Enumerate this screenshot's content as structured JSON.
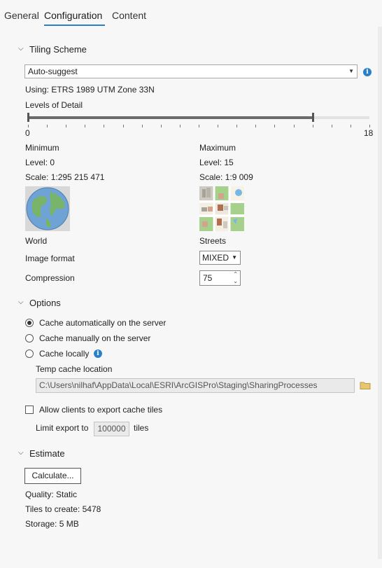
{
  "tabs": [
    {
      "label": "General"
    },
    {
      "label": "Configuration"
    },
    {
      "label": "Content"
    }
  ],
  "tiling_scheme": {
    "title": "Tiling Scheme",
    "selected": "Auto-suggest",
    "using_label": "Using:",
    "using_value": "ETRS 1989 UTM Zone 33N",
    "lod_label": "Levels of Detail",
    "lod_min_tick": "0",
    "lod_max_tick": "18",
    "minimum": {
      "title": "Minimum",
      "level_label": "Level:",
      "level_value": "0",
      "scale_label": "Scale:",
      "scale_value": "1:295 215 471",
      "image_caption": "World"
    },
    "maximum": {
      "title": "Maximum",
      "level_label": "Level:",
      "level_value": "15",
      "scale_label": "Scale:",
      "scale_value": "1:9 009",
      "image_caption": "Streets"
    },
    "image_format_label": "Image format",
    "image_format_value": "MIXED",
    "compression_label": "Compression",
    "compression_value": "75"
  },
  "options": {
    "title": "Options",
    "radios": [
      {
        "label": "Cache automatically on the server",
        "checked": true
      },
      {
        "label": "Cache manually on the server",
        "checked": false
      },
      {
        "label": "Cache locally",
        "checked": false
      }
    ],
    "temp_cache_label": "Temp cache location",
    "temp_cache_path": "C:\\Users\\nilhaf\\AppData\\Local\\ESRI\\ArcGISPro\\Staging\\SharingProcesses",
    "allow_export_label": "Allow clients to export cache tiles",
    "limit_export_label": "Limit export to",
    "limit_export_value": "100000",
    "limit_export_unit": "tiles"
  },
  "estimate": {
    "title": "Estimate",
    "calculate_label": "Calculate...",
    "quality_label": "Quality:",
    "quality_value": "Static",
    "tiles_label": "Tiles to create:",
    "tiles_value": "5478",
    "storage_label": "Storage:",
    "storage_value": "5 MB"
  },
  "lod": {
    "min": 0,
    "max": 18,
    "selected_min": 0,
    "selected_max": 15
  },
  "colors": {
    "accent": "#2a7fc9",
    "info": "#2a7fc9"
  },
  "icons": [
    "chevron-down-icon",
    "info-icon",
    "folder-icon",
    "globe-icon",
    "streets-map-icon"
  ]
}
